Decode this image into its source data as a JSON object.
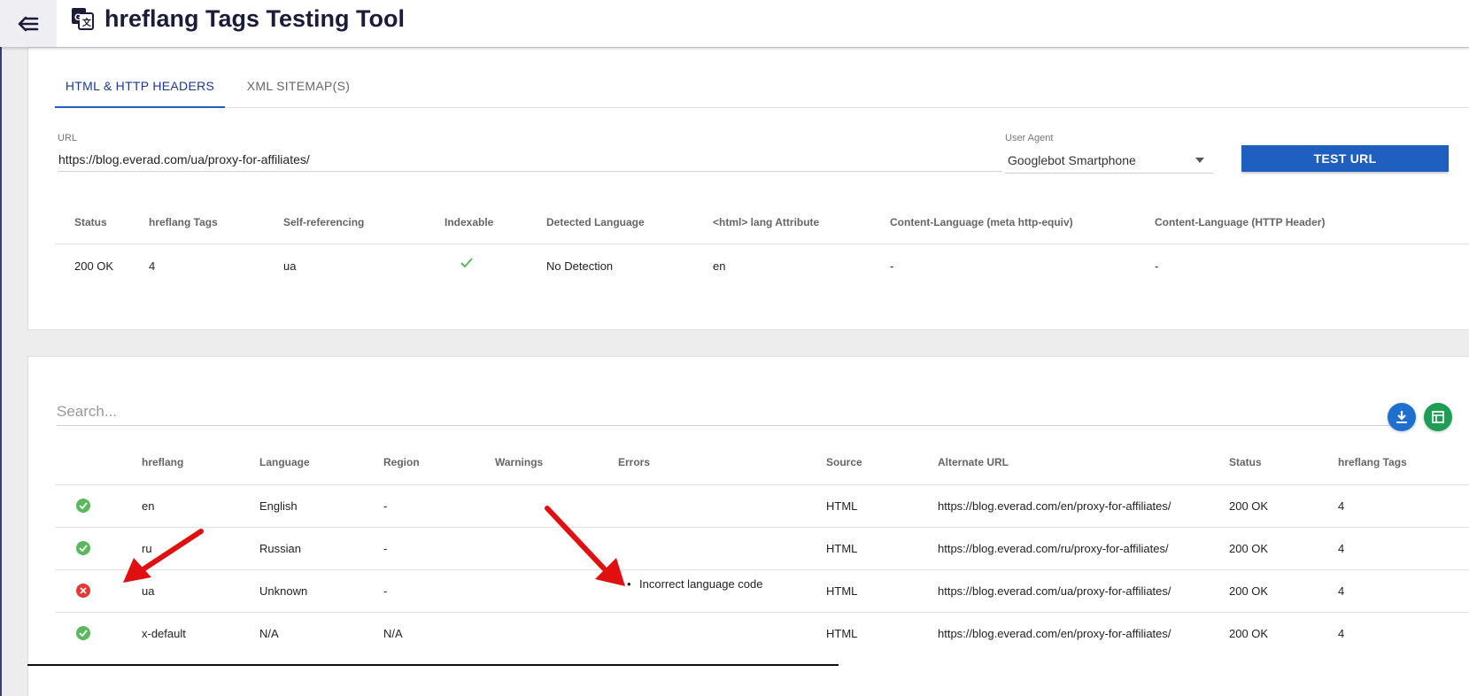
{
  "app": {
    "title": "hreflang Tags Testing Tool",
    "back_icon": "arrow-back-menu-icon",
    "app_icon": "translate-icon"
  },
  "tabs": [
    {
      "label": "HTML & HTTP HEADERS",
      "active": true
    },
    {
      "label": "XML SITEMAP(S)",
      "active": false
    }
  ],
  "form": {
    "url_label": "URL",
    "url_value": "https://blog.everad.com/ua/proxy-for-affiliates/",
    "user_agent_label": "User Agent",
    "user_agent_value": "Googlebot Smartphone",
    "test_button": "TEST URL"
  },
  "summary": {
    "headers": [
      "Status",
      "hreflang Tags",
      "Self-referencing",
      "Indexable",
      "Detected Language",
      "<html> lang Attribute",
      "Content-Language (meta http-equiv)",
      "Content-Language (HTTP Header)"
    ],
    "row": {
      "status": "200 OK",
      "hreflang_tags": "4",
      "self_referencing": "ua",
      "indexable": "check-icon",
      "detected_language": "No Detection",
      "html_lang": "en",
      "meta_content_language": "-",
      "http_content_language": "-"
    }
  },
  "results": {
    "search_placeholder": "Search...",
    "download_icon": "download-icon",
    "sheets_icon": "google-sheets-icon",
    "headers": [
      "hreflang",
      "Language",
      "Region",
      "Warnings",
      "Errors",
      "Source",
      "Alternate URL",
      "Status",
      "hreflang Tags"
    ],
    "rows": [
      {
        "state": "ok",
        "hreflang": "en",
        "language": "English",
        "region": "-",
        "warnings": "",
        "errors": "",
        "source": "HTML",
        "alternate_url": "https://blog.everad.com/en/proxy-for-affiliates/",
        "status": "200 OK",
        "tags": "4"
      },
      {
        "state": "ok",
        "hreflang": "ru",
        "language": "Russian",
        "region": "-",
        "warnings": "",
        "errors": "",
        "source": "HTML",
        "alternate_url": "https://blog.everad.com/ru/proxy-for-affiliates/",
        "status": "200 OK",
        "tags": "4"
      },
      {
        "state": "error",
        "hreflang": "ua",
        "language": "Unknown",
        "region": "-",
        "warnings": "",
        "errors": "Incorrect language code",
        "source": "HTML",
        "alternate_url": "https://blog.everad.com/ua/proxy-for-affiliates/",
        "status": "200 OK",
        "tags": "4"
      },
      {
        "state": "ok",
        "hreflang": "x-default",
        "language": "N/A",
        "region": "N/A",
        "warnings": "",
        "errors": "",
        "source": "HTML",
        "alternate_url": "https://blog.everad.com/en/proxy-for-affiliates/",
        "status": "200 OK",
        "tags": "4"
      }
    ]
  },
  "colors": {
    "accent": "#1f5fbf",
    "ok": "#5cb85c",
    "error": "#e53935",
    "annotation_arrow": "#e01010"
  }
}
